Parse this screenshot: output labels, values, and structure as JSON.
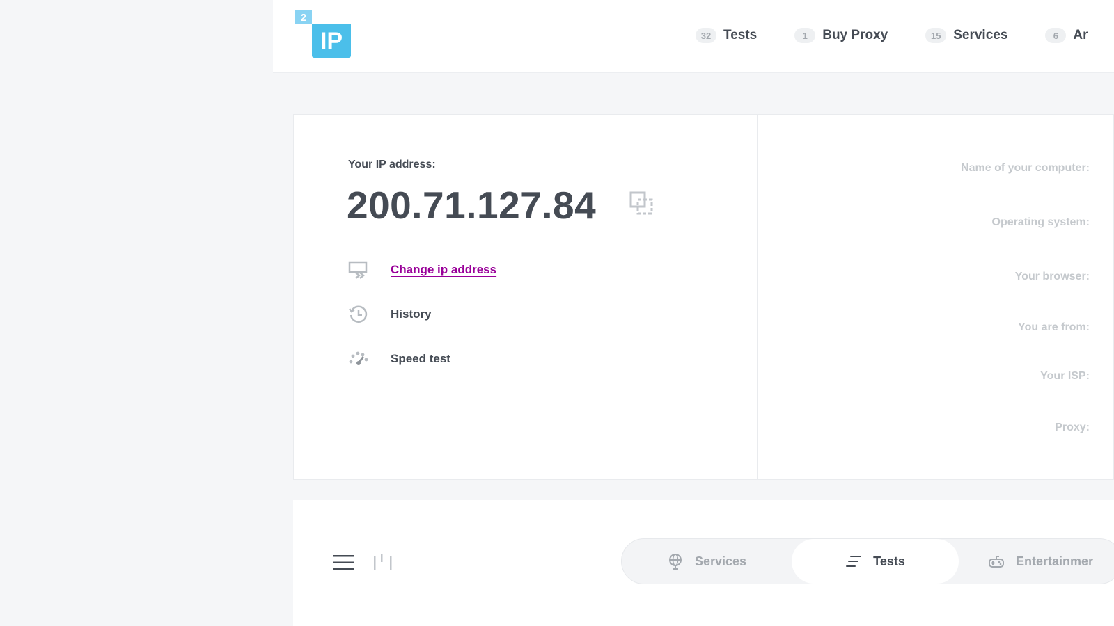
{
  "logo": {
    "small": "2",
    "big": "IP"
  },
  "nav": [
    {
      "count": "32",
      "label": "Tests"
    },
    {
      "count": "1",
      "label": "Buy Proxy"
    },
    {
      "count": "15",
      "label": "Services"
    },
    {
      "count": "6",
      "label": "Ar"
    }
  ],
  "ip": {
    "label": "Your IP address:",
    "value": "200.71.127.84"
  },
  "actions": {
    "change": "Change ip address",
    "history": "History",
    "speed": "Speed test"
  },
  "info": {
    "computer": "Name of your computer:",
    "os": "Operating system:",
    "browser": "Your browser:",
    "from": "You are from:",
    "isp": "Your ISP:",
    "proxy": "Proxy:"
  },
  "tabs": [
    {
      "label": "Services",
      "icon": "globe-icon",
      "active": false
    },
    {
      "label": "Tests",
      "icon": "sort-lines-icon",
      "active": true
    },
    {
      "label": "Entertainmer",
      "icon": "gamepad-icon",
      "active": false
    }
  ],
  "colors": {
    "logo_primary": "#4bbfea",
    "logo_secondary": "#89d3f3",
    "link": "#990099",
    "text": "#454b54",
    "muted": "#c5c9cd"
  }
}
